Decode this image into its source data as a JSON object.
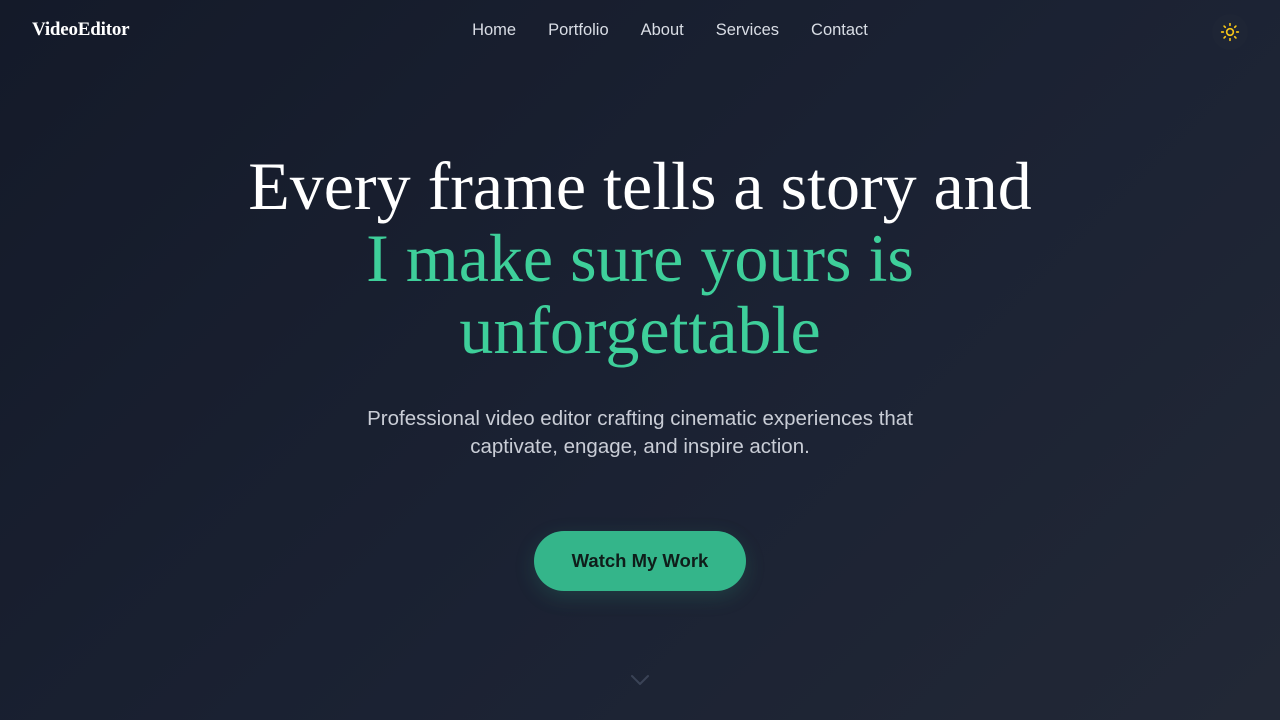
{
  "header": {
    "logo": "VideoEditor",
    "nav": [
      {
        "label": "Home"
      },
      {
        "label": "Portfolio"
      },
      {
        "label": "About"
      },
      {
        "label": "Services"
      },
      {
        "label": "Contact"
      }
    ],
    "theme_toggle_icon": "sun-icon"
  },
  "hero": {
    "title_line1": "Every frame tells a story and",
    "title_accent_line1": "I make sure yours is",
    "title_accent_line2": "unforgettable",
    "subtitle_line1": "Professional video editor crafting cinematic experiences that",
    "subtitle_line2": "captivate, engage, and inspire action.",
    "cta_label": "Watch My Work",
    "scroll_icon": "chevron-down-icon"
  },
  "colors": {
    "background": "#161c2b",
    "accent": "#3ecf9a",
    "button": "#34b58a",
    "sun": "#f5c518"
  }
}
